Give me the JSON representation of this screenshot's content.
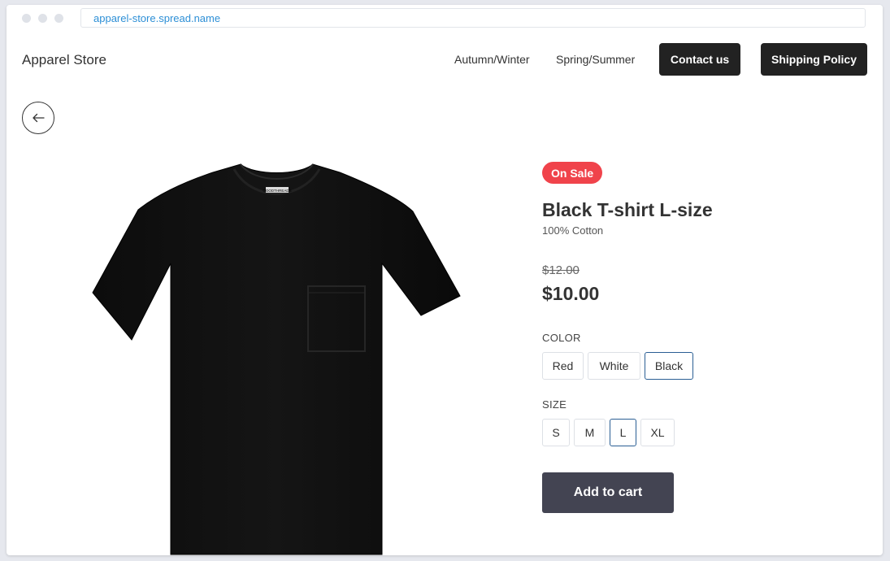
{
  "browser": {
    "url": "apparel-store.spread.name"
  },
  "header": {
    "brand": "Apparel Store",
    "nav_links": [
      "Autumn/Winter",
      "Spring/Summer"
    ],
    "contact_label": "Contact us",
    "shipping_label": "Shipping Policy"
  },
  "product": {
    "badge": "On Sale",
    "title": "Black T-shirt L-size",
    "material": "100% Cotton",
    "old_price": "$12.00",
    "price": "$10.00",
    "image_icon": "tshirt-image",
    "brand_tag": "GOODTHREADS",
    "color_label": "COLOR",
    "colors": [
      "Red",
      "White",
      "Black"
    ],
    "selected_color": "Black",
    "size_label": "SIZE",
    "sizes": [
      "S",
      "M",
      "L",
      "XL"
    ],
    "selected_size": "L",
    "add_to_cart_label": "Add to cart"
  },
  "colors": {
    "badge": "#f0434b",
    "primary_dark": "#222222",
    "cart_button": "#434452",
    "selected_border": "#2b5f94",
    "url": "#2d8fd6"
  }
}
